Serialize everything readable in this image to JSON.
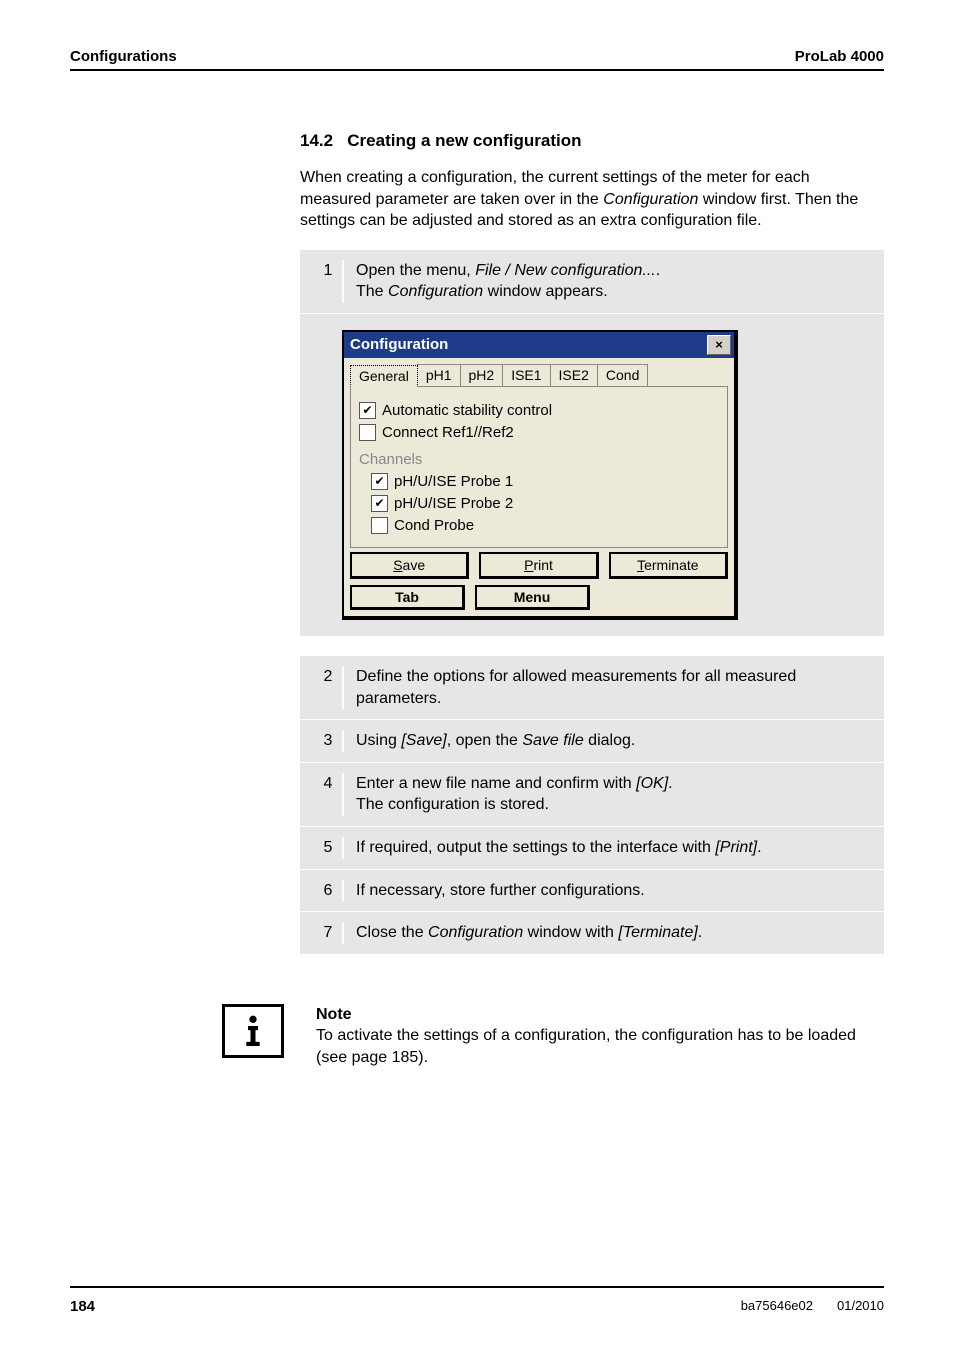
{
  "header": {
    "left": "Configurations",
    "right": "ProLab 4000"
  },
  "section": {
    "number": "14.2",
    "title": "Creating a new configuration",
    "intro": "When creating a configuration, the current settings of the meter for each measured parameter are taken over in the ",
    "intro_italic1": "Configuration",
    "intro_mid": " window first. Then the settings can be adjusted and stored as an extra configuration file."
  },
  "step1": {
    "num": "1",
    "prefix": "Open the menu, ",
    "menu1": "File",
    "sep": "  /  ",
    "menu2": "New configuration...",
    "suffix": ".",
    "line2a": "The ",
    "line2i": "Configuration",
    "line2b": " window appears."
  },
  "dialog": {
    "title": "Configuration",
    "tabs": [
      "General",
      "pH1",
      "pH2",
      "ISE1",
      "ISE2",
      "Cond"
    ],
    "opt_auto": "Automatic stability control",
    "opt_connect": "Connect Ref1//Ref2",
    "group": "Channels",
    "ch1": "pH/U/ISE Probe 1",
    "ch2": "pH/U/ISE Probe 2",
    "ch3": "Cond Probe",
    "btn_save": "Save",
    "btn_save_ul": "S",
    "btn_print": "Print",
    "btn_print_ul": "P",
    "btn_term": "Terminate",
    "btn_term_ul": "T",
    "btn_tab": "Tab",
    "btn_menu": "Menu",
    "close": "×"
  },
  "steps": [
    {
      "num": "2",
      "text": "Define the options for allowed measurements for all measured parameters."
    },
    {
      "num": "3",
      "pre": "Using ",
      "i1": "[Save]",
      "mid": ", open the ",
      "i2": "Save file",
      "post": " dialog."
    },
    {
      "num": "4",
      "pre": "Enter a new file name and confirm with ",
      "i1": "[OK]",
      "mid": ".",
      "line2": "The configuration is stored."
    },
    {
      "num": "5",
      "pre": "If required, output the settings to the interface with ",
      "i1": "[Print]",
      "post": "."
    },
    {
      "num": "6",
      "text": "If necessary, store further configurations."
    },
    {
      "num": "7",
      "pre": "Close the ",
      "i1": "Configuration",
      "mid": " window with ",
      "i2": "[Terminate]",
      "post": "."
    }
  ],
  "note": {
    "label": "Note",
    "text": "To activate the settings of a configuration, the configuration has to be loaded (see page 185)."
  },
  "footer": {
    "page": "184",
    "doc": "ba75646e02",
    "date": "01/2010"
  }
}
